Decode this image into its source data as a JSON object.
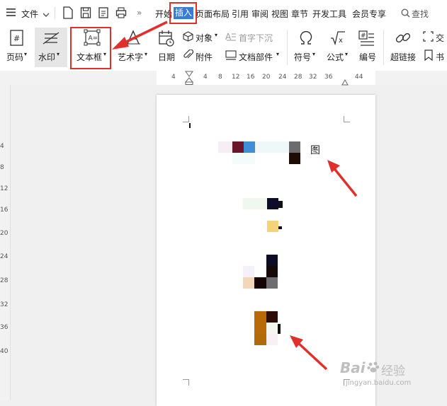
{
  "menubar": {
    "file_label": "文件",
    "tabs": [
      "开始",
      "插入",
      "页面布局",
      "引用",
      "审阅",
      "视图",
      "章节",
      "开发工具",
      "会员专享"
    ],
    "active_tab": "插入",
    "search_label": "查找"
  },
  "ribbon": {
    "page_number": "页码",
    "watermark": "水印",
    "text_box": "文本框",
    "art_text": "艺术字",
    "date": "日期",
    "object": "对象",
    "attachment": "附件",
    "drop_cap": "首字下沉",
    "doc_parts": "文档部件",
    "symbol": "符号",
    "formula": "公式",
    "numbering": "编号",
    "hyperlink": "超链接",
    "cross_ref": "交",
    "bookmark": "书"
  },
  "ruler": {
    "ticks": [
      "4",
      "4",
      "8",
      "12",
      "16",
      "20",
      "24",
      "28",
      "32",
      "36",
      "44"
    ]
  },
  "vruler": {
    "ticks": [
      "4",
      "8",
      "12",
      "16",
      "20",
      "24",
      "28",
      "32",
      "36",
      "40"
    ]
  },
  "document": {
    "line1_char": "图"
  },
  "watermark": {
    "brand": "Bai",
    "brand_suffix": "经验",
    "url": "jingyan.baidu.com"
  },
  "colors": {
    "annotation_red": "#e0302c",
    "active_tab_blue": "#3a7bd5"
  }
}
